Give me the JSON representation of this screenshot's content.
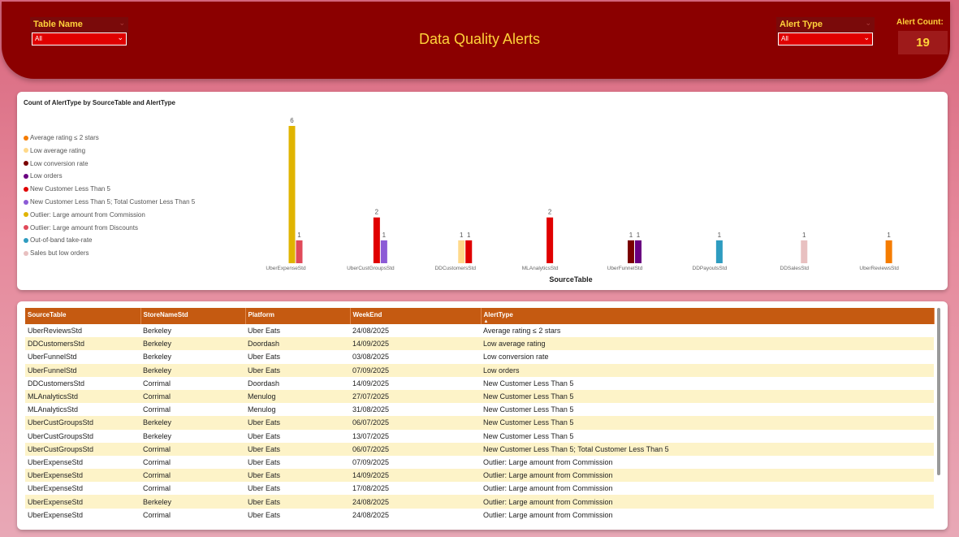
{
  "header": {
    "title": "Data Quality Alerts",
    "table_slicer": {
      "label": "Table Name",
      "value": "All"
    },
    "alert_slicer": {
      "label": "Alert Type",
      "value": "All"
    },
    "alert_count": {
      "label": "Alert Count:",
      "value": "19"
    }
  },
  "chart_data": {
    "type": "bar",
    "title": "Count of AlertType by SourceTable and AlertType",
    "xlabel": "SourceTable",
    "ylabel": "",
    "ylim": [
      0,
      6
    ],
    "categories": [
      "UberExpenseStd",
      "UberCustGroupsStd",
      "DDCustomersStd",
      "MLAnalyticsStd",
      "UberFunnelStd",
      "DDPayoutsStd",
      "DDSalesStd",
      "UberReviewsStd"
    ],
    "series": [
      {
        "name": "Average rating ≤ 2 stars",
        "color": "#f57c00",
        "values": [
          0,
          0,
          0,
          0,
          0,
          0,
          0,
          1
        ]
      },
      {
        "name": "Low average rating",
        "color": "#ffd98a",
        "values": [
          0,
          0,
          1,
          0,
          0,
          0,
          0,
          0
        ]
      },
      {
        "name": "Low conversion rate",
        "color": "#7a0000",
        "values": [
          0,
          0,
          0,
          0,
          1,
          0,
          0,
          0
        ]
      },
      {
        "name": "Low orders",
        "color": "#6a0080",
        "values": [
          0,
          0,
          0,
          0,
          1,
          0,
          0,
          0
        ]
      },
      {
        "name": "New Customer Less Than 5",
        "color": "#e00000",
        "values": [
          0,
          2,
          1,
          2,
          0,
          0,
          0,
          0
        ]
      },
      {
        "name": "New Customer Less Than 5; Total Customer Less Than 5",
        "color": "#8c5bd6",
        "values": [
          0,
          1,
          0,
          0,
          0,
          0,
          0,
          0
        ]
      },
      {
        "name": "Outlier: Large amount from Commission",
        "color": "#e0b400",
        "values": [
          6,
          0,
          0,
          0,
          0,
          0,
          0,
          0
        ]
      },
      {
        "name": "Outlier: Large amount from Discounts",
        "color": "#e04a5a",
        "values": [
          1,
          0,
          0,
          0,
          0,
          0,
          0,
          0
        ]
      },
      {
        "name": "Out-of-band take-rate",
        "color": "#2e9cc0",
        "values": [
          0,
          0,
          0,
          0,
          0,
          1,
          0,
          0
        ]
      },
      {
        "name": "Sales but low orders",
        "color": "#e8c0c0",
        "values": [
          0,
          0,
          0,
          0,
          0,
          0,
          1,
          0
        ]
      }
    ]
  },
  "table": {
    "columns": [
      "SourceTable",
      "StoreNameStd",
      "Platform",
      "WeekEnd",
      "AlertType"
    ],
    "sort_column": "AlertType",
    "rows": [
      [
        "UberReviewsStd",
        "Berkeley",
        "Uber Eats",
        "24/08/2025",
        "Average rating ≤ 2 stars"
      ],
      [
        "DDCustomersStd",
        "Berkeley",
        "Doordash",
        "14/09/2025",
        "Low average rating"
      ],
      [
        "UberFunnelStd",
        "Berkeley",
        "Uber Eats",
        "03/08/2025",
        "Low conversion rate"
      ],
      [
        "UberFunnelStd",
        "Berkeley",
        "Uber Eats",
        "07/09/2025",
        "Low orders"
      ],
      [
        "DDCustomersStd",
        "Corrimal",
        "Doordash",
        "14/09/2025",
        "New Customer Less Than 5"
      ],
      [
        "MLAnalyticsStd",
        "Corrimal",
        "Menulog",
        "27/07/2025",
        "New Customer Less Than 5"
      ],
      [
        "MLAnalyticsStd",
        "Corrimal",
        "Menulog",
        "31/08/2025",
        "New Customer Less Than 5"
      ],
      [
        "UberCustGroupsStd",
        "Berkeley",
        "Uber Eats",
        "06/07/2025",
        "New Customer Less Than 5"
      ],
      [
        "UberCustGroupsStd",
        "Berkeley",
        "Uber Eats",
        "13/07/2025",
        "New Customer Less Than 5"
      ],
      [
        "UberCustGroupsStd",
        "Corrimal",
        "Uber Eats",
        "06/07/2025",
        "New Customer Less Than 5; Total Customer Less Than 5"
      ],
      [
        "UberExpenseStd",
        "Corrimal",
        "Uber Eats",
        "07/09/2025",
        "Outlier: Large amount from Commission"
      ],
      [
        "UberExpenseStd",
        "Corrimal",
        "Uber Eats",
        "14/09/2025",
        "Outlier: Large amount from Commission"
      ],
      [
        "UberExpenseStd",
        "Corrimal",
        "Uber Eats",
        "17/08/2025",
        "Outlier: Large amount from Commission"
      ],
      [
        "UberExpenseStd",
        "Berkeley",
        "Uber Eats",
        "24/08/2025",
        "Outlier: Large amount from Commission"
      ],
      [
        "UberExpenseStd",
        "Corrimal",
        "Uber Eats",
        "24/08/2025",
        "Outlier: Large amount from Commission"
      ]
    ]
  }
}
